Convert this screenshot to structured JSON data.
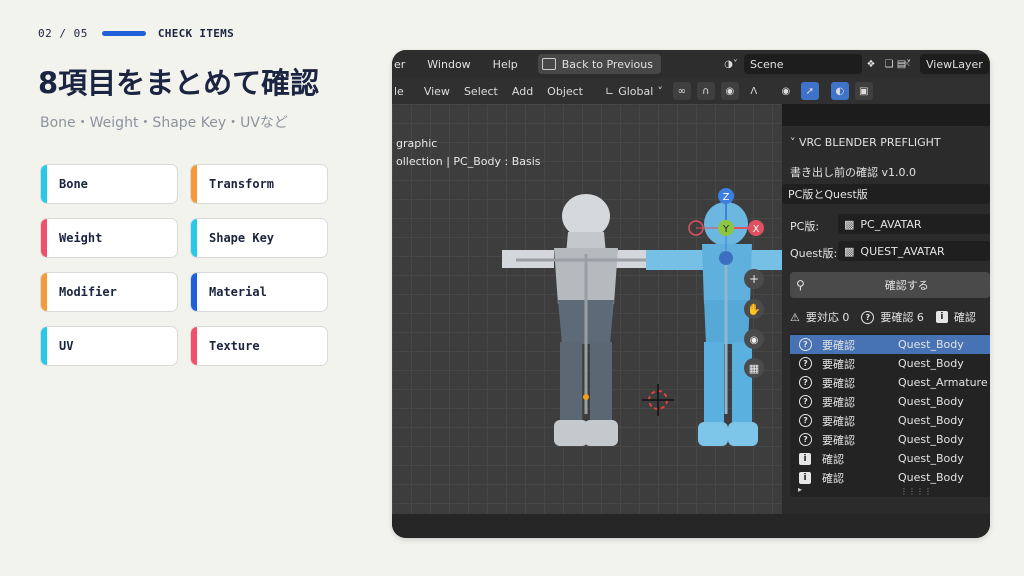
{
  "header": {
    "page_number": "02 / 05",
    "section_label": "CHECK ITEMS",
    "accent_color": "#1f5fd9"
  },
  "title": "8項目をまとめて確認",
  "subtitle": "Bone・Weight・Shape Key・UVなど",
  "cards": [
    {
      "label": "Bone",
      "accent": "#26c9e6"
    },
    {
      "label": "Transform",
      "accent": "#f59a3a"
    },
    {
      "label": "Weight",
      "accent": "#f0506c"
    },
    {
      "label": "Shape Key",
      "accent": "#26c9e6"
    },
    {
      "label": "Modifier",
      "accent": "#f59a3a"
    },
    {
      "label": "Material",
      "accent": "#1f5fd9"
    },
    {
      "label": "UV",
      "accent": "#26c9e6"
    },
    {
      "label": "Texture",
      "accent": "#f0506c"
    }
  ],
  "blender": {
    "topbar": {
      "menu_partial": "er",
      "menus": [
        "Window",
        "Help"
      ],
      "back_button": "Back to Previous",
      "scene": "Scene",
      "view_layer": "ViewLayer"
    },
    "toolbar": {
      "menu_partial": "le",
      "menus": [
        "View",
        "Select",
        "Add",
        "Object"
      ],
      "transform_orientation": "Global"
    },
    "viewport": {
      "view_name": "graphic",
      "collection_line": "ollection | PC_Body : Basis",
      "gizmo_axes": [
        "Z",
        "Y",
        "X"
      ]
    },
    "panel": {
      "title": "VRC BLENDER PREFLIGHT",
      "version_line": "書き出し前の確認 v1.0.0",
      "mode": "PC版とQuest版",
      "pc_label": "PC版:",
      "pc_value": "PC_AVATAR",
      "quest_label": "Quest版:",
      "quest_value": "QUEST_AVATAR",
      "check_button": "確認する",
      "summary": {
        "action_required": "要対応 0",
        "needs_review": "要確認 6",
        "info": "確認"
      },
      "results": [
        {
          "icon": "question",
          "status": "要確認",
          "object": "Quest_Body",
          "selected": true
        },
        {
          "icon": "question",
          "status": "要確認",
          "object": "Quest_Body",
          "selected": false
        },
        {
          "icon": "question",
          "status": "要確認",
          "object": "Quest_Armature",
          "selected": false
        },
        {
          "icon": "question",
          "status": "要確認",
          "object": "Quest_Body",
          "selected": false
        },
        {
          "icon": "question",
          "status": "要確認",
          "object": "Quest_Body",
          "selected": false
        },
        {
          "icon": "question",
          "status": "要確認",
          "object": "Quest_Body",
          "selected": false
        },
        {
          "icon": "info",
          "status": "確認",
          "object": "Quest_Body",
          "selected": false
        },
        {
          "icon": "info",
          "status": "確認",
          "object": "Quest_Body",
          "selected": false
        }
      ]
    }
  }
}
